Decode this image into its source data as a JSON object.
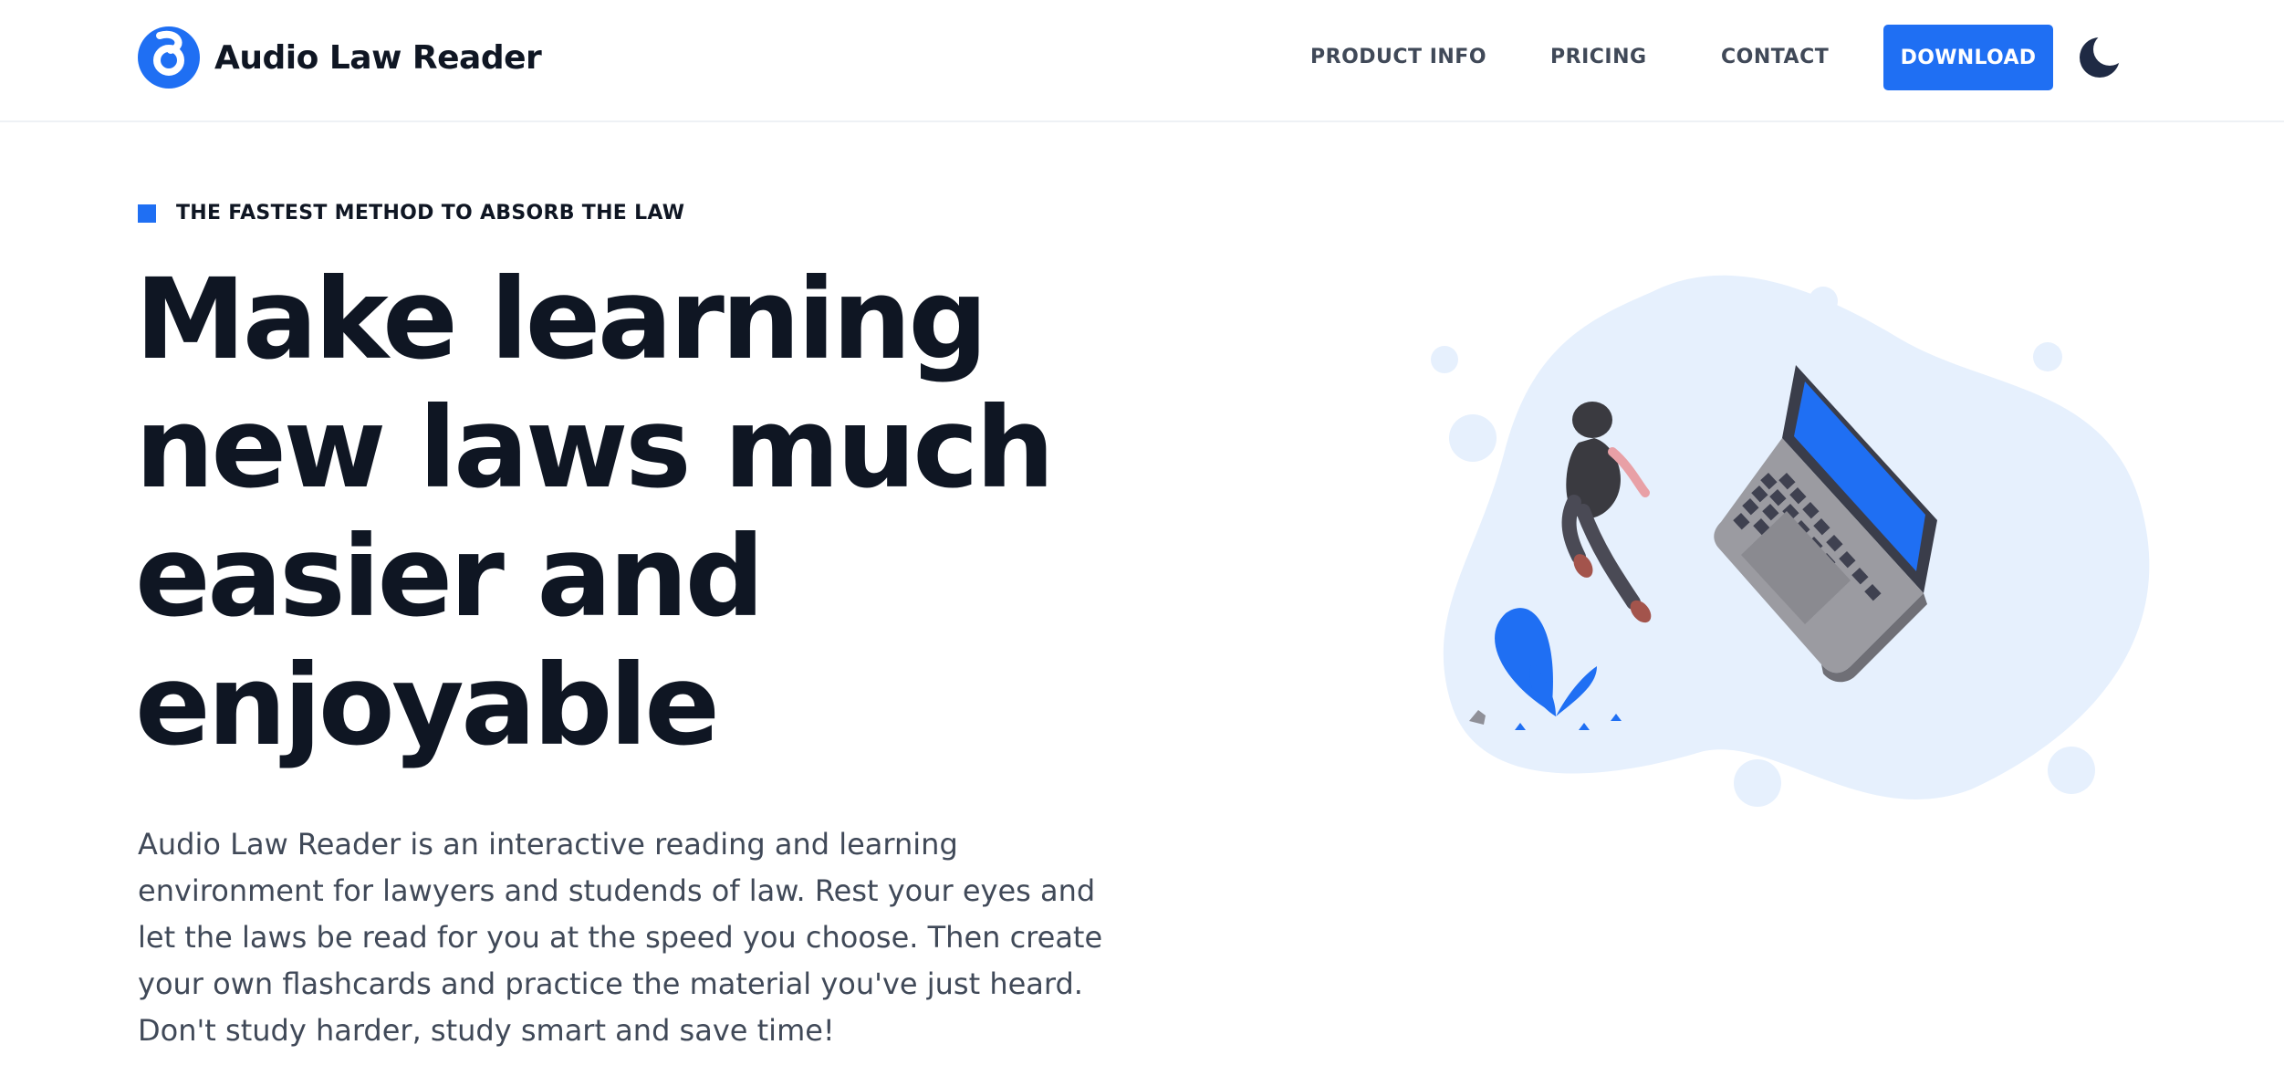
{
  "brand": {
    "name": "Audio Law Reader",
    "logo_icon": "brand-logo-icon",
    "accent": "#1f6ff3"
  },
  "nav": {
    "items": [
      {
        "label": "PRODUCT INFO"
      },
      {
        "label": "PRICING"
      },
      {
        "label": "CONTACT"
      }
    ],
    "download_label": "DOWNLOAD",
    "theme_icon": "moon-icon"
  },
  "hero": {
    "eyebrow": "THE FASTEST METHOD TO ABSORB THE LAW",
    "headline_lines": [
      "Make learning",
      "new laws much",
      "easier and",
      "enjoyable"
    ],
    "description": "Audio Law Reader is an interactive reading and learning environment for lawyers and studends of law. Rest your eyes and let the laws be read for you at the speed you choose. Then create your own flashcards and practice the material you've just heard. Don't study harder, study smart and save time!",
    "illustration": "person-walking-to-laptop-illustration"
  }
}
